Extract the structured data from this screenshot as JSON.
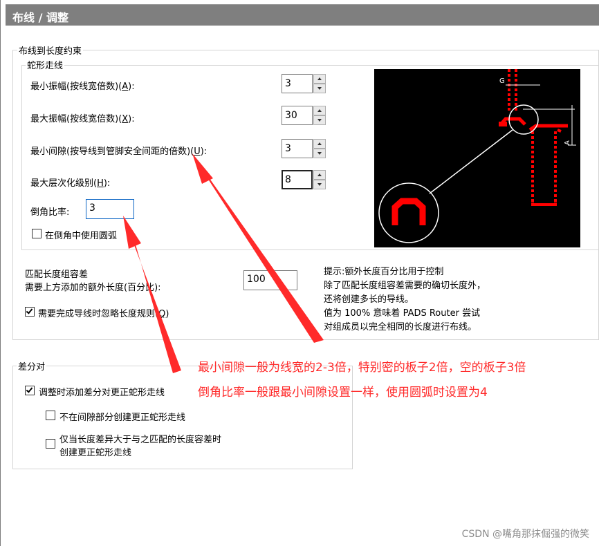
{
  "window": {
    "title": "布线 / 调整"
  },
  "length_group": {
    "legend": "布线到长度约束",
    "serpentine": {
      "legend": "蛇形走线",
      "min_amp": {
        "label_pre": "最小振幅(按线宽倍数)(",
        "key": "A",
        "label_post": "):",
        "value": "3"
      },
      "max_amp": {
        "label_pre": "最大振幅(按线宽倍数)(",
        "key": "X",
        "label_post": "):",
        "value": "30"
      },
      "min_gap": {
        "label_pre": "最小间隙(按导线到管脚安全间距的倍数)(",
        "key": "U",
        "label_post": "):",
        "value": "3"
      },
      "max_level": {
        "label_pre": "最大层次化级别(",
        "key": "H",
        "label_post": "):",
        "value": "8"
      },
      "chamfer": {
        "label": "倒角比率:",
        "value": "3"
      },
      "use_arc": {
        "label": "在倒角中使用圆弧",
        "checked": false
      }
    },
    "tolerance": {
      "line1": "匹配长度组容差",
      "line2": "需要上方添加的额外长度(百分比):",
      "value": "100"
    },
    "ignore_rule": {
      "label_pre": "需要完成导线时忽略长度规则(",
      "key": "Q",
      "label_post": ")",
      "checked": true
    },
    "hint_lines": [
      "提示:额外长度百分比用于控制",
      "除了匹配长度组容差需要的确切长度外，",
      "还将创建多长的导线。",
      "值为 100% 意味着 PADS Router 尝试",
      "对组成员以完全相同的长度进行布线。"
    ],
    "preview": {
      "label_g": "G",
      "label_a": "A",
      "trace_color": "#ff0000"
    }
  },
  "diff_pair": {
    "legend": "差分对",
    "add_serpentine": {
      "label": "调整时添加差分对更正蛇形走线",
      "checked": true
    },
    "no_gap": {
      "label": "不在间隙部分创建更正蛇形走线",
      "checked": false
    },
    "only_when": {
      "line1": "仅当长度差异大于与之匹配的长度容差时",
      "line2": "创建更正蛇形走线",
      "checked": false
    }
  },
  "annotations": {
    "line1": "最小间隙一般为线宽的2-3倍，特别密的板子2倍，空的板子3倍",
    "line2": "倒角比率一般跟最小间隙设置一样，使用圆弧时设置为4",
    "color": "#ff2a2a"
  },
  "watermark": "CSDN @嘴角那抹倔强的微笑"
}
